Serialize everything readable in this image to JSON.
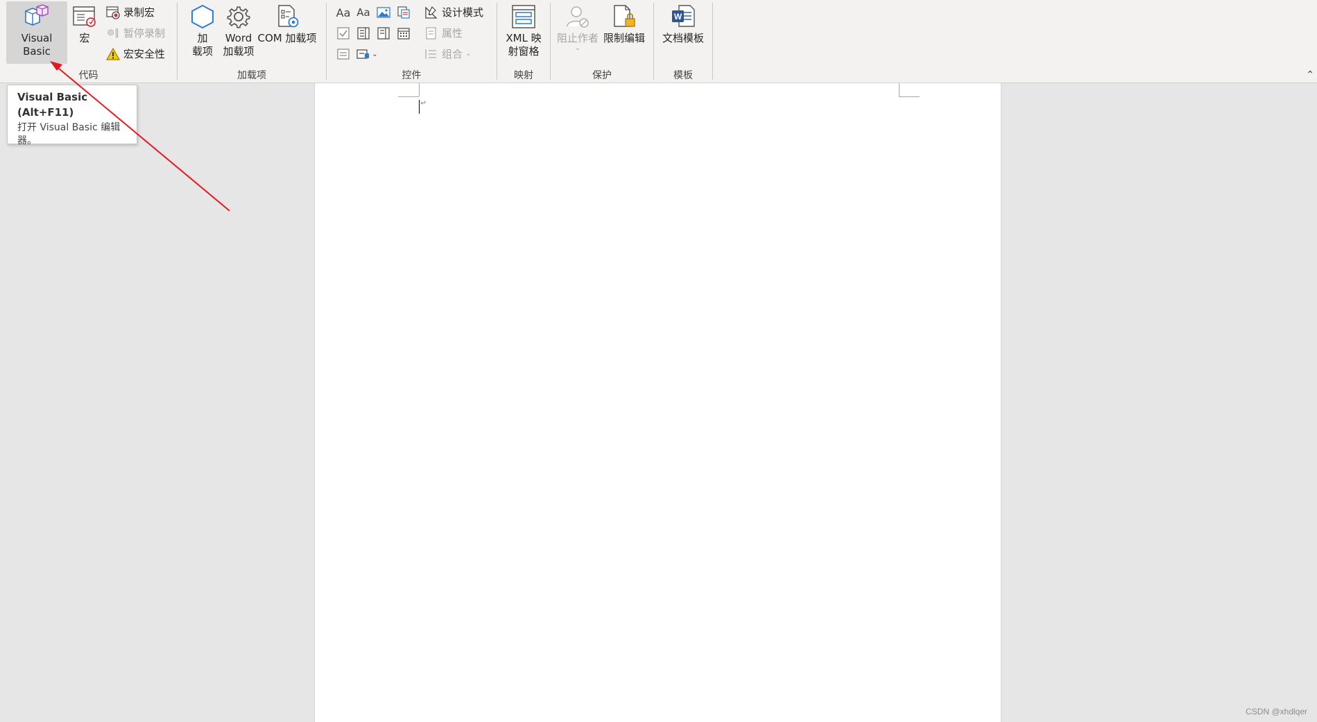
{
  "ribbon": {
    "code": {
      "label": "代码",
      "visual_basic": "Visual Basic",
      "macros": "宏",
      "record_macro": "录制宏",
      "pause_recording": "暂停录制",
      "macro_security": "宏安全性"
    },
    "addins": {
      "label": "加载项",
      "addins_btn_line1": "加",
      "addins_btn_line2": "载项",
      "word_addins_line1": "Word",
      "word_addins_line2": "加载项",
      "com_addins": "COM 加载项"
    },
    "controls": {
      "label": "控件",
      "design_mode": "设计模式",
      "properties": "属性",
      "group": "组合",
      "rich_text_glyph": "Aa",
      "plain_text_glyph": "Aa"
    },
    "mapping": {
      "label": "映射",
      "xml_pane_line1": "XML 映",
      "xml_pane_line2": "射窗格"
    },
    "protect": {
      "label": "保护",
      "block_authors": "阻止作者",
      "restrict_editing": "限制编辑"
    },
    "templates": {
      "label": "模板",
      "document_template": "文档模板"
    }
  },
  "tooltip": {
    "title": "Visual Basic (Alt+F11)",
    "desc_line1": "打开 Visual Basic 编辑",
    "desc_line2": "器。"
  },
  "document": {
    "paragraph_mark": "↵"
  },
  "watermark": "CSDN @xhdlqer",
  "colors": {
    "ribbon_bg": "#f3f2f1",
    "canvas_bg": "#e6e6e6",
    "arrow": "#e8161a",
    "word_blue": "#2b579a"
  }
}
